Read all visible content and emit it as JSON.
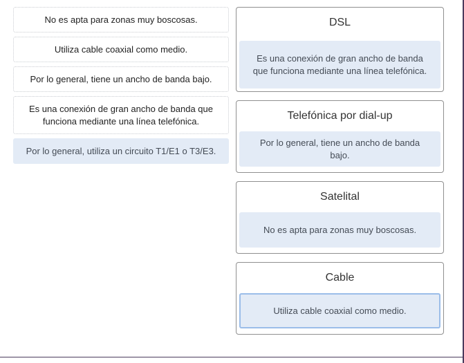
{
  "options": [
    {
      "text": "No es apta para zonas muy boscosas.",
      "state": "placed"
    },
    {
      "text": "Utiliza cable coaxial como medio.",
      "state": "placed"
    },
    {
      "text": "Por lo general, tiene un ancho de banda bajo.",
      "state": "placed"
    },
    {
      "text": "Es una conexión de gran ancho de banda que funciona mediante una línea telefónica.",
      "state": "placed"
    },
    {
      "text": "Por lo general, utiliza un circuito T1/E1 o T3/E3.",
      "state": "unplaced"
    }
  ],
  "targets": [
    {
      "title": "DSL",
      "answer": "Es una conexión de gran ancho de banda que funciona mediante una línea telefónica."
    },
    {
      "title": "Telefónica por dial-up",
      "answer": "Por lo general, tiene un ancho de banda bajo."
    },
    {
      "title": "Satelital",
      "answer": "No es apta para zonas muy boscosas."
    },
    {
      "title": "Cable",
      "answer": "Utiliza cable coaxial como medio.",
      "selected": true
    }
  ],
  "colors": {
    "filled_background": "#e3ebf6",
    "selected_border": "#9bbde9",
    "target_border": "#8f8f8f"
  }
}
